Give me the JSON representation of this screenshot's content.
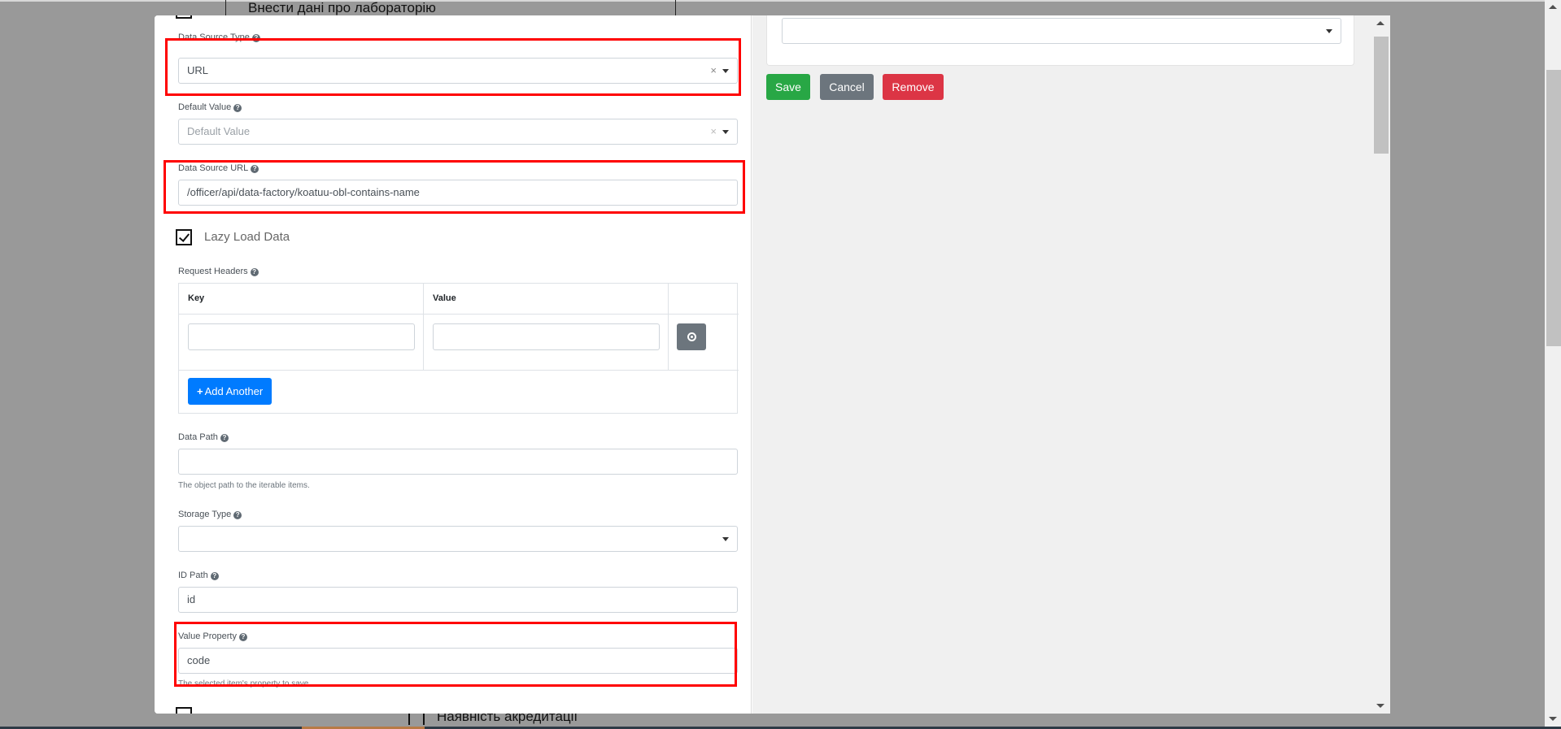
{
  "background": {
    "top_title": "Внести дані про лабораторію",
    "bottom_checkbox_label": "Наявність акредитації"
  },
  "form": {
    "data_source_type": {
      "label": "Data Source Type",
      "value": "URL",
      "clear": "×"
    },
    "default_value": {
      "label": "Default Value",
      "placeholder": "Default Value",
      "clear": "×"
    },
    "data_source_url": {
      "label": "Data Source URL",
      "value": "/officer/api/data-factory/koatuu-obl-contains-name"
    },
    "lazy_load": {
      "label": "Lazy Load Data",
      "checked": true
    },
    "request_headers": {
      "label": "Request Headers",
      "columns": [
        "Key",
        "Value"
      ],
      "rows": [
        {
          "key": "",
          "value": ""
        }
      ],
      "add_label": "Add Another",
      "add_icon": "+"
    },
    "data_path": {
      "label": "Data Path",
      "value": "",
      "help": "The object path to the iterable items."
    },
    "storage_type": {
      "label": "Storage Type",
      "value": ""
    },
    "id_path": {
      "label": "ID Path",
      "value": "id"
    },
    "value_property": {
      "label": "Value Property",
      "value": "code",
      "help": "The selected item's property to save."
    },
    "help_icon": "?"
  },
  "actions": {
    "save": "Save",
    "cancel": "Cancel",
    "remove": "Remove"
  },
  "colors": {
    "highlight": "#ff0000",
    "save": "#28a745",
    "cancel": "#6c757d",
    "remove": "#dc3545",
    "add": "#007bff"
  }
}
